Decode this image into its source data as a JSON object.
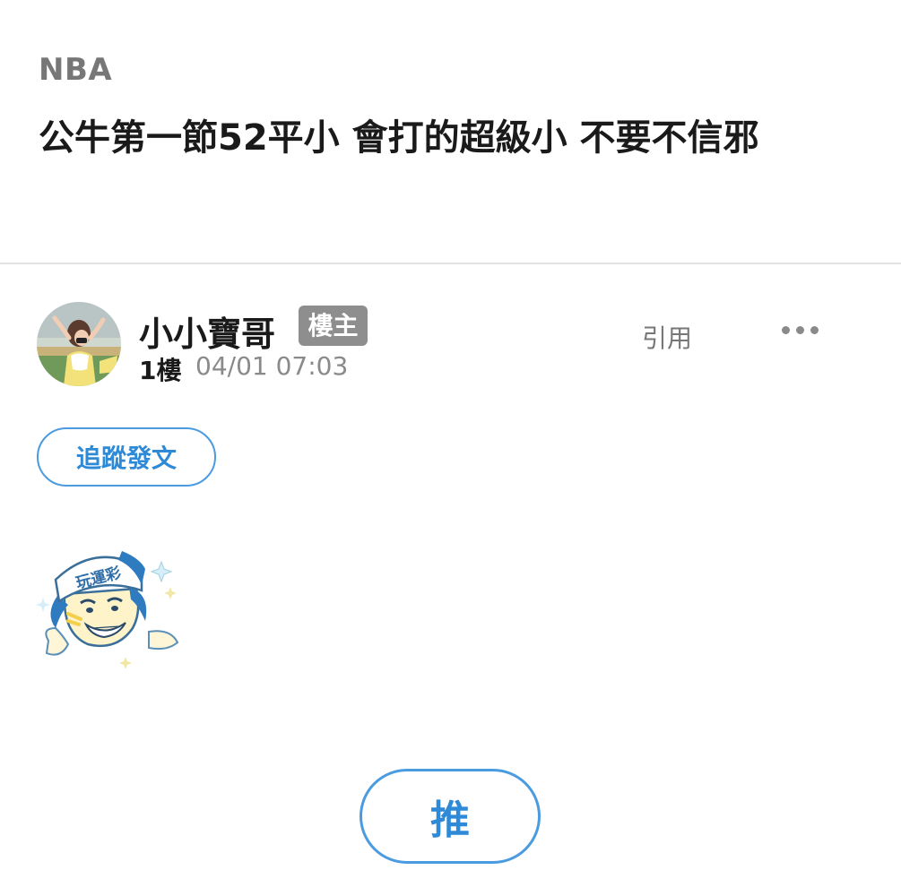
{
  "header": {
    "board_name": "NBA",
    "title": "公牛第一節52平小 會打的超級小 不要不信邪"
  },
  "post": {
    "author": {
      "name": "小小寶哥",
      "badge": "樓主",
      "avatar": "avatar-photo"
    },
    "floor": "1樓",
    "timestamp": "04/01 07:03",
    "quote_label": "引用",
    "more_icon": "more-dots-icon",
    "follow_label": "追蹤發文",
    "sticker": {
      "icon": "sticker-icon",
      "cap_text": "玩運彩"
    }
  },
  "actions": {
    "push_label": "推"
  },
  "colors": {
    "accent": "#2e8ad6",
    "badge_bg": "#8e8e8e",
    "muted_text": "#8a8a8a"
  }
}
